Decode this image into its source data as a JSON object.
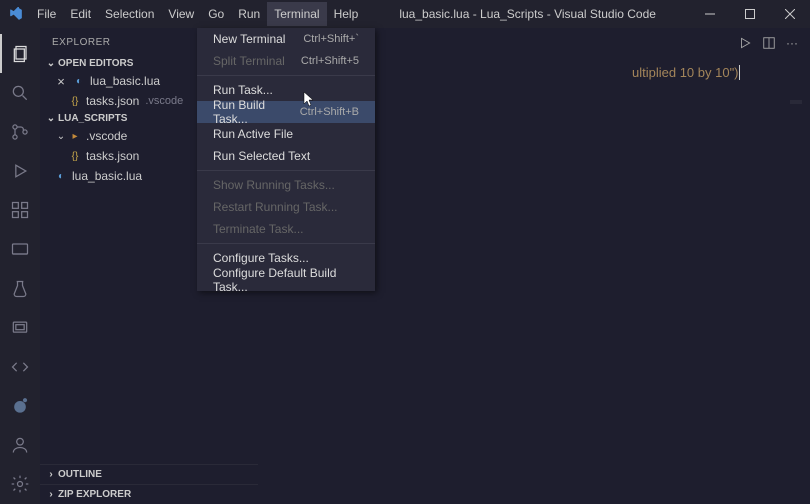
{
  "title": "lua_basic.lua - Lua_Scripts - Visual Studio Code",
  "menu": {
    "file": "File",
    "edit": "Edit",
    "selection": "Selection",
    "view": "View",
    "go": "Go",
    "run": "Run",
    "terminal": "Terminal",
    "help": "Help"
  },
  "sidebar": {
    "title": "EXPLORER",
    "open_editors": "OPEN EDITORS",
    "project": "LUA_SCRIPTS",
    "outline": "OUTLINE",
    "zip": "ZIP EXPLORER",
    "files": {
      "lua_basic": "lua_basic.lua",
      "tasks": "tasks.json",
      "tasks_dim": ".vscode",
      "vscode_folder": ".vscode"
    }
  },
  "tabs": {
    "tasks": "tasks.json"
  },
  "dropdown": {
    "new_terminal": {
      "label": "New Terminal",
      "shortcut": "Ctrl+Shift+`"
    },
    "split_terminal": {
      "label": "Split Terminal",
      "shortcut": "Ctrl+Shift+5"
    },
    "run_task": "Run Task...",
    "run_build": {
      "label": "Run Build Task...",
      "shortcut": "Ctrl+Shift+B"
    },
    "run_active": "Run Active File",
    "run_selected": "Run Selected Text",
    "show_running": "Show Running Tasks...",
    "restart": "Restart Running Task...",
    "terminate": "Terminate Task...",
    "configure": "Configure Tasks...",
    "configure_default": "Configure Default Build Task..."
  },
  "code": {
    "visible": "ultiplied 10 by 10\")"
  }
}
